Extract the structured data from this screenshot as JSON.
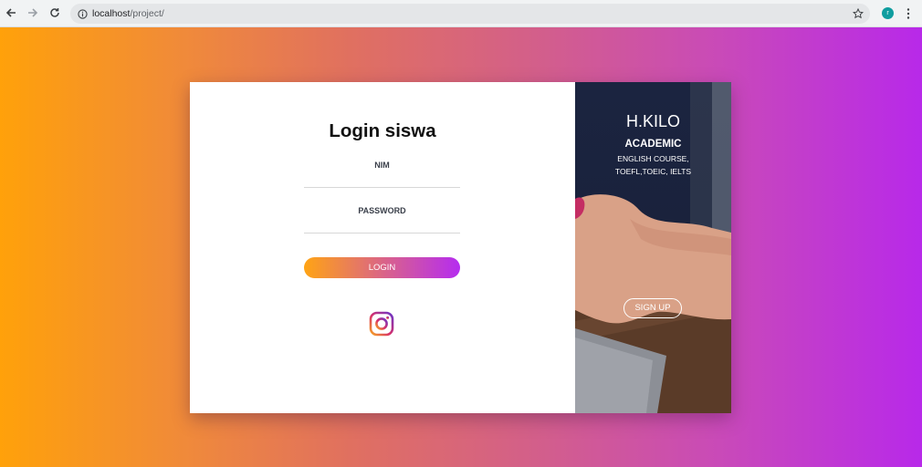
{
  "browser": {
    "url_host": "localhost",
    "url_path": "/project/",
    "profile_initial": "r"
  },
  "login": {
    "title": "Login siswa",
    "nim_placeholder": "NIM",
    "password_placeholder": "PASSWORD",
    "login_button": "LOGIN",
    "social_icon": "instagram-icon"
  },
  "promo": {
    "brand": "H.KILO",
    "academic": "ACADEMIC",
    "course_line1": "ENGLISH COURSE,",
    "course_line2": "TOEFL,TOEIC, IELTS",
    "signup_button": "SIGN UP"
  },
  "colors": {
    "gradient_start": "#ffa10a",
    "gradient_end": "#b829e9",
    "card_background": "#ffffff",
    "promo_background": "#1b2440"
  }
}
